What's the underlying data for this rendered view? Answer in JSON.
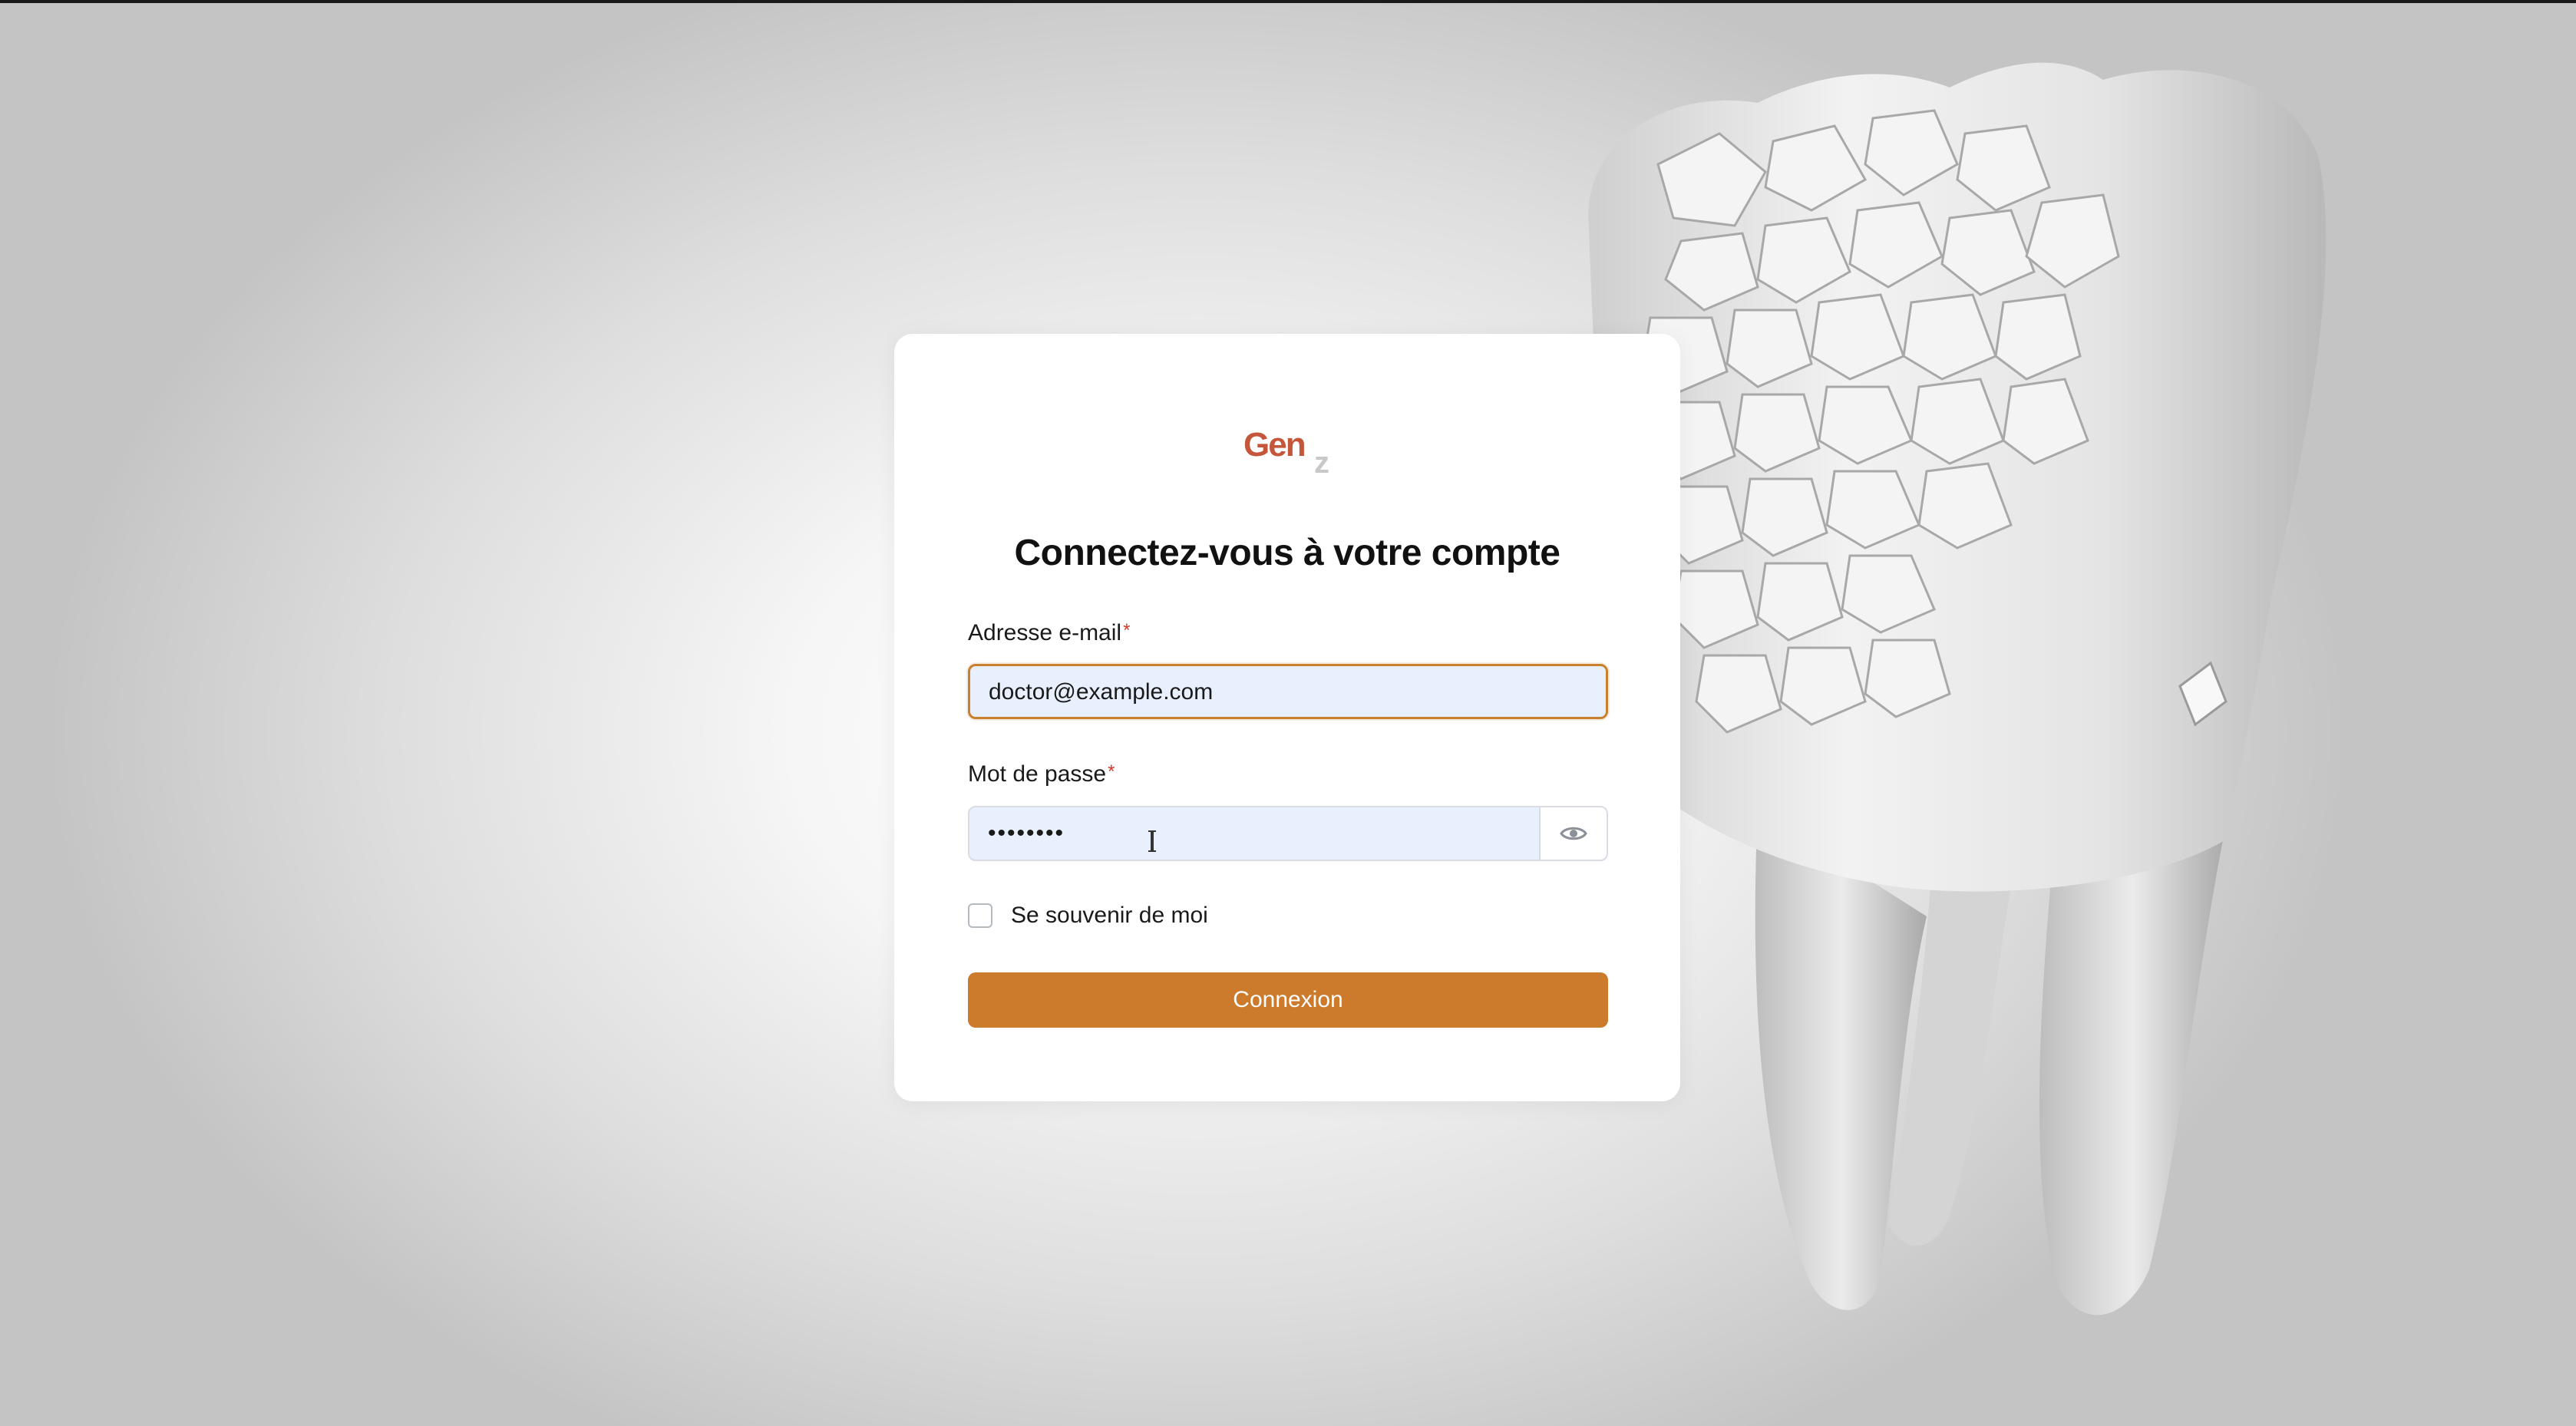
{
  "brand": {
    "logo_main": "Gen",
    "logo_sub": "z",
    "accent_color": "#cc7a2b",
    "logo_color": "#c4563b"
  },
  "login": {
    "title": "Connectez-vous à votre compte",
    "email_label": "Adresse e-mail",
    "email_value": "doctor@example.com",
    "password_label": "Mot de passe",
    "password_value": "••••••••",
    "required_marker": "*",
    "remember_label": "Se souvenir de moi",
    "remember_checked": false,
    "submit_label": "Connexion",
    "show_password_icon": "eye-icon"
  },
  "background": {
    "illustration": "shattered-tooth"
  }
}
